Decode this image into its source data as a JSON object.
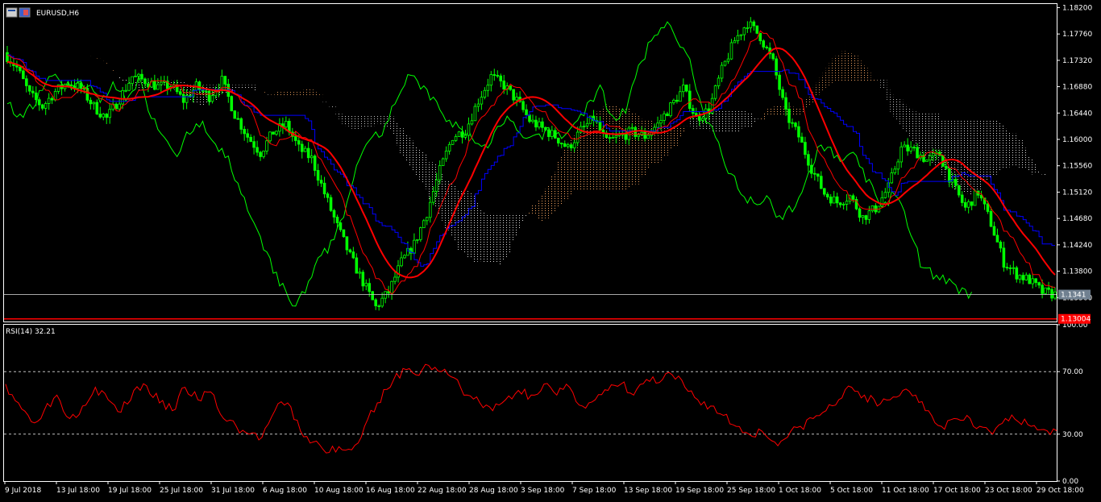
{
  "window": {
    "symbol_title": "EURUSD,H6",
    "indicator_title": "RSI(14) 32.21"
  },
  "colors": {
    "background": "#000000",
    "frame": "#ffffff",
    "candle": "#00ff00",
    "chikou": "#00ff00",
    "tenkan": "#ff0000",
    "kijun": "#0000ff",
    "ma": "#ff0000",
    "cloud_bull": "#f4a460",
    "cloud_bear": "#d8d8d8",
    "rsi": "#ff0000",
    "bid_line": "#c0c0c0",
    "price_marker_bg": "#ff0000",
    "bid_marker_bg": "#708090"
  },
  "chart_data": [
    {
      "type": "candlestick",
      "title": "EURUSD,H6",
      "ylim": [
        1.1296,
        1.1826
      ],
      "y_ticks": [
        "1.18200",
        "1.17760",
        "1.17320",
        "1.16880",
        "1.16440",
        "1.16000",
        "1.15560",
        "1.15120",
        "1.14680",
        "1.14240",
        "1.13800",
        "1.13360"
      ],
      "x_ticks": [
        "9 Jul 2018",
        "13 Jul 18:00",
        "19 Jul 18:00",
        "25 Jul 18:00",
        "31 Jul 18:00",
        "6 Aug 18:00",
        "10 Aug 18:00",
        "16 Aug 18:00",
        "22 Aug 18:00",
        "28 Aug 18:00",
        "3 Sep 18:00",
        "7 Sep 18:00",
        "13 Sep 18:00",
        "19 Sep 18:00",
        "25 Sep 18:00",
        "1 Oct 18:00",
        "5 Oct 18:00",
        "11 Oct 18:00",
        "17 Oct 18:00",
        "23 Oct 18:00",
        "29 Oct 18:00"
      ],
      "closes": [
        1.1745,
        1.172,
        1.1675,
        1.1655,
        1.168,
        1.1695,
        1.1685,
        1.1655,
        1.1635,
        1.1668,
        1.1705,
        1.1698,
        1.1688,
        1.169,
        1.1665,
        1.1688,
        1.1672,
        1.1698,
        1.1642,
        1.1605,
        1.1578,
        1.1612,
        1.1625,
        1.1585,
        1.1568,
        1.151,
        1.1455,
        1.1405,
        1.1362,
        1.132,
        1.1345,
        1.1395,
        1.1425,
        1.1478,
        1.1548,
        1.1605,
        1.1615,
        1.1665,
        1.1705,
        1.169,
        1.1665,
        1.1632,
        1.1618,
        1.1605,
        1.1585,
        1.1615,
        1.1635,
        1.1595,
        1.1605,
        1.1612,
        1.1605,
        1.1625,
        1.1655,
        1.1685,
        1.1635,
        1.165,
        1.1715,
        1.1765,
        1.1795,
        1.1772,
        1.1728,
        1.1642,
        1.1605,
        1.1552,
        1.151,
        1.1495,
        1.1505,
        1.147,
        1.1485,
        1.152,
        1.1585,
        1.1582,
        1.1565,
        1.1575,
        1.1525,
        1.1485,
        1.1512,
        1.146,
        1.1395,
        1.1375,
        1.1365,
        1.1345,
        1.1341
      ],
      "last_price": 1.1341,
      "low_marker": 1.13004,
      "series": [
        {
          "name": "Tenkan-sen"
        },
        {
          "name": "Kijun-sen"
        },
        {
          "name": "Chikou Span"
        },
        {
          "name": "Senkou Span A"
        },
        {
          "name": "Senkou Span B"
        },
        {
          "name": "Moving Average"
        }
      ]
    },
    {
      "type": "line",
      "title": "RSI(14) 32.21",
      "ylim": [
        0,
        100
      ],
      "y_ticks": [
        "100.00",
        "70.00",
        "30.00",
        "0.00"
      ],
      "levels": [
        70,
        30
      ],
      "series": [
        {
          "name": "RSI(14)",
          "values": [
            62,
            50,
            38,
            45,
            55,
            40,
            48,
            60,
            52,
            44,
            58,
            61,
            50,
            45,
            60,
            52,
            57,
            40,
            35,
            30,
            28,
            45,
            50,
            32,
            25,
            18,
            22,
            20,
            35,
            50,
            60,
            72,
            68,
            74,
            70,
            66,
            55,
            50,
            45,
            52,
            58,
            55,
            62,
            55,
            60,
            48,
            52,
            58,
            62,
            55,
            65,
            63,
            68,
            60,
            52,
            48,
            42,
            35,
            30,
            32,
            25,
            28,
            35,
            40,
            45,
            52,
            60,
            55,
            48,
            52,
            58,
            55,
            45,
            35,
            40,
            42,
            35,
            30,
            40,
            38,
            35,
            33,
            32.21
          ]
        }
      ]
    }
  ]
}
